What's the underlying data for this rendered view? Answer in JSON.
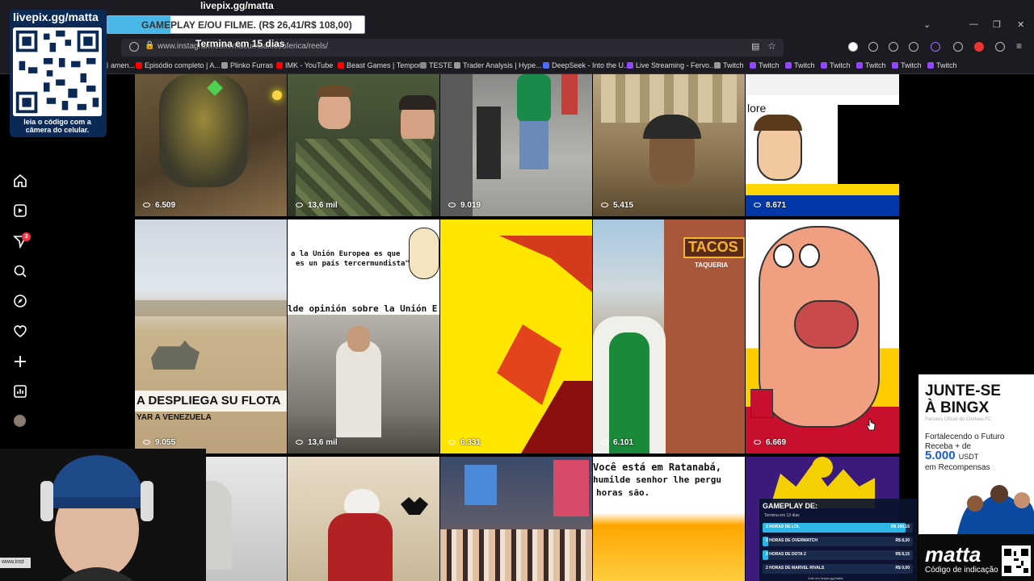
{
  "stream": {
    "site": "livepix.gg/matta",
    "promo_text": "GAMEPLAY E/OU FILME. (R$ 26,41/R$ 108,00)",
    "promo_progress": 0.245,
    "promo_sub": "Termina em 15 dias",
    "qr_title": "livepix.gg/matta",
    "qr_caption": "leia o código com a câmera do celular."
  },
  "browser": {
    "url": "www.instagram.com/macumbafilosoferica/reels/",
    "status_url": "www.inst",
    "bookmarks": [
      {
        "label": "amen...",
        "icon": "folder-icon",
        "color": "#666666"
      },
      {
        "label": "Episódio completo | A...",
        "icon": "youtube-icon",
        "color": "#ff0000"
      },
      {
        "label": "Plinko Furras",
        "icon": "globe-icon",
        "color": "#999999"
      },
      {
        "label": "IMK - YouTube",
        "icon": "youtube-icon",
        "color": "#ff0000"
      },
      {
        "label": "Beast Games | Tempor...",
        "icon": "youtube-icon",
        "color": "#ff0000"
      },
      {
        "label": "TESTE",
        "icon": "folder-icon",
        "color": "#888888"
      },
      {
        "label": "Trader Analysis | Hype...",
        "icon": "globe-icon",
        "color": "#999999"
      },
      {
        "label": "DeepSeek - Into the U...",
        "icon": "deepseek-icon",
        "color": "#4d6bfe"
      },
      {
        "label": "Live Streaming - Fervo...",
        "icon": "twitch-icon",
        "color": "#9146ff"
      },
      {
        "label": "Twitch",
        "icon": "globe-icon",
        "color": "#999999"
      },
      {
        "label": "Twitch",
        "icon": "twitch-icon",
        "color": "#9146ff"
      },
      {
        "label": "Twitch",
        "icon": "twitch-icon",
        "color": "#9146ff"
      },
      {
        "label": "Twitch",
        "icon": "twitch-icon",
        "color": "#9146ff"
      },
      {
        "label": "Twitch",
        "icon": "twitch-icon",
        "color": "#9146ff"
      },
      {
        "label": "Twitch",
        "icon": "twitch-icon",
        "color": "#9146ff"
      },
      {
        "label": "Twitch",
        "icon": "twitch-icon",
        "color": "#9146ff"
      }
    ]
  },
  "sidebar": {
    "notification_count": "3",
    "items": [
      "home-icon",
      "reels-icon",
      "messages-icon",
      "search-icon",
      "explore-icon",
      "notifications-icon",
      "create-icon",
      "dashboard-icon",
      "profile-avatar",
      "more-menu-icon",
      "apps-icon"
    ]
  },
  "reels": [
    {
      "views": "6.509",
      "theme": "robot"
    },
    {
      "views": "13,6 mil",
      "theme": "soldiers"
    },
    {
      "views": "9.019",
      "theme": "dancer"
    },
    {
      "views": "5.415",
      "theme": "painting"
    },
    {
      "views": "8.671",
      "theme": "cartoon"
    },
    {
      "views": "9.055",
      "theme": "desert",
      "caption": "A DESPLIEGA SU FLOTA",
      "subcaption": "YAR A VENEZUELA"
    },
    {
      "views": "13,6 mil",
      "theme": "meme",
      "caption": "a la Unión Europea es que",
      "caption2": "es un país tercermundista\"",
      "caption3": "lde opinión sobre la Unión E"
    },
    {
      "views": "6.331",
      "theme": "yellow"
    },
    {
      "views": "6.101",
      "theme": "street",
      "sign": "TACOS",
      "subsign": "TAQUERIA"
    },
    {
      "views": "6.669",
      "theme": "face"
    },
    {
      "theme": "statue"
    },
    {
      "theme": "sultan"
    },
    {
      "theme": "city"
    },
    {
      "theme": "text",
      "caption": "Você está em Ratanabá,",
      "caption2": "humilde senhor lhe pergu",
      "caption3": "horas são."
    },
    {
      "theme": "wheel"
    }
  ],
  "ads": {
    "bingx_title_1": "JUNTE-SE",
    "bingx_title_2": "À BINGX",
    "bingx_small": "Parceiro Oficial do Chelsea FC",
    "bingx_line1": "Fortalecendo o Futuro",
    "bingx_line2": "Receba + de",
    "bingx_amount": "5.000",
    "bingx_unit": "USDT",
    "bingx_line3": "em Recompensas",
    "matta_brand": "matta",
    "matta_sub": "Código de indicação"
  },
  "gameplay": {
    "title": "GAMEPLAY DE:",
    "sub": "Termina em 13 dias",
    "rows": [
      {
        "label": "2 HORAS DE LOL",
        "price": "R$ 100,15",
        "progress": 0.95
      },
      {
        "label": "2 HORAS DE OVERWATCH",
        "price": "R$ 8,30",
        "progress": 0.04
      },
      {
        "label": "2 HORAS DE DOTA 2",
        "price": "R$ 8,15",
        "progress": 0.04
      },
      {
        "label": "2 HORAS DE MARVEL RIVALS",
        "price": "R$ 0,00",
        "progress": 0
      }
    ],
    "footer": "Vote em livepix.gg/matta"
  }
}
